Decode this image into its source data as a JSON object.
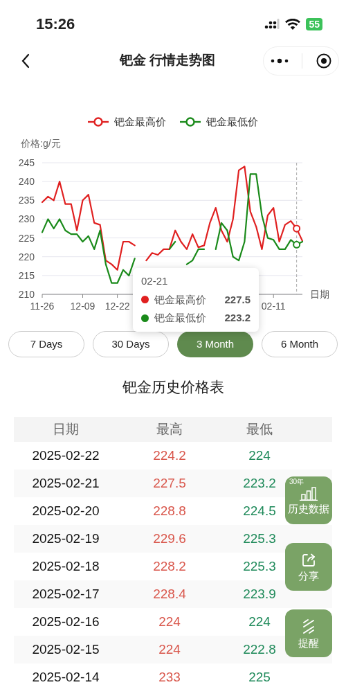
{
  "status_bar": {
    "time": "15:26",
    "battery": "55"
  },
  "nav": {
    "title": "钯金 行情走势图"
  },
  "chart": {
    "chart_data": {
      "type": "line",
      "ylabel": "价格:g/元",
      "xlabel": "日期",
      "categories": [
        "11-26",
        null,
        null,
        null,
        null,
        null,
        null,
        "12-09",
        null,
        null,
        null,
        null,
        null,
        "12-22",
        null,
        null,
        null,
        null,
        null,
        null,
        null,
        null,
        null,
        null,
        null,
        null,
        null,
        null,
        null,
        null,
        null,
        null,
        null,
        null,
        null,
        null,
        null,
        null,
        null,
        null,
        "02-11",
        null,
        null,
        null,
        null,
        null
      ],
      "ylim": [
        210,
        245
      ],
      "yticks": [
        210,
        215,
        220,
        225,
        230,
        235,
        240,
        245
      ],
      "series": [
        {
          "name": "钯金最高价",
          "color": "#e02020",
          "values": [
            234.5,
            236,
            235,
            240,
            234,
            234,
            227,
            235,
            236.5,
            229,
            228.5,
            219,
            218,
            216.5,
            224,
            224,
            223,
            null,
            219,
            221,
            220.5,
            222,
            222,
            227,
            224,
            222,
            226,
            222.5,
            223,
            229,
            233,
            227,
            224,
            230,
            243,
            244,
            232,
            228,
            222,
            231,
            233,
            224,
            228.5,
            229.5,
            227.5,
            224.2
          ]
        },
        {
          "name": "钯金最低价",
          "color": "#1a8a1a",
          "values": [
            226.5,
            230,
            227.5,
            230,
            227,
            226,
            226,
            224,
            225.5,
            222,
            227,
            218,
            213,
            213,
            216.5,
            215,
            219.5,
            null,
            null,
            null,
            null,
            null,
            222,
            224,
            null,
            218,
            219,
            222,
            222,
            null,
            222,
            229,
            227,
            220,
            219,
            224,
            242,
            242,
            231,
            225,
            224.5,
            222,
            222,
            224.5,
            223.2,
            224
          ]
        }
      ],
      "grid": true
    },
    "tooltip": {
      "date": "02-21",
      "rows": [
        {
          "label": "钯金最高价",
          "value": "227.5",
          "color": "#e02020"
        },
        {
          "label": "钯金最低价",
          "value": "223.2",
          "color": "#1a8a1a"
        }
      ]
    }
  },
  "ranges": [
    {
      "label": "7 Days",
      "selected": false
    },
    {
      "label": "30 Days",
      "selected": false
    },
    {
      "label": "3 Month",
      "selected": true
    },
    {
      "label": "6 Month",
      "selected": false
    }
  ],
  "table": {
    "title": "钯金历史价格表",
    "columns": [
      "日期",
      "最高",
      "最低"
    ],
    "rows": [
      {
        "date": "2025-02-22",
        "high": "224.2",
        "low": "224"
      },
      {
        "date": "2025-02-21",
        "high": "227.5",
        "low": "223.2"
      },
      {
        "date": "2025-02-20",
        "high": "228.8",
        "low": "224.5"
      },
      {
        "date": "2025-02-19",
        "high": "229.6",
        "low": "225.3"
      },
      {
        "date": "2025-02-18",
        "high": "228.2",
        "low": "225.3"
      },
      {
        "date": "2025-02-17",
        "high": "228.4",
        "low": "223.9"
      },
      {
        "date": "2025-02-16",
        "high": "224",
        "low": "224"
      },
      {
        "date": "2025-02-15",
        "high": "224",
        "low": "222.8"
      },
      {
        "date": "2025-02-14",
        "high": "233",
        "low": "225"
      }
    ]
  },
  "float_buttons": [
    {
      "kind": "history",
      "badge": "30年",
      "label": "历史数据"
    },
    {
      "kind": "share",
      "label": "分享"
    },
    {
      "kind": "remind",
      "label": "提醒"
    }
  ]
}
